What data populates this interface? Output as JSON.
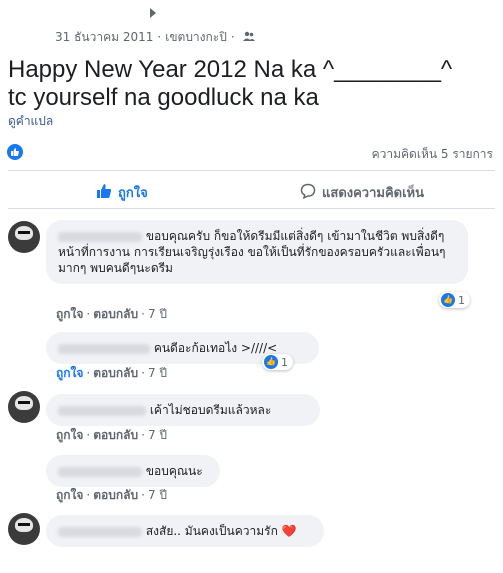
{
  "post": {
    "date": "31 ธันวาคม 2011",
    "location": "เขตบางกะปิ",
    "audience_icon": "friends-icon",
    "text_line1": "Happy New Year 2012 Na ka ^________^",
    "text_line2": "tc yourself na goodluck na ka",
    "see_translation": "ดูคำแปล",
    "comment_count": "ความคิดเห็น 5 รายการ"
  },
  "actions": {
    "like_label": "ถูกใจ",
    "comment_label": "แสดงความคิดเห็น"
  },
  "comments": [
    {
      "text": "ขอบคุณครับ ก็ขอให้ดรีมมีแต่สิ่งดีๆ เข้ามาในชีวิต พบสิ่งดีๆ หน้าที่การงาน การเรียนเจริญรุ่งเรือง ขอให้เป็นที่รักของครอบครัวและเพื่อนๆ มากๆ พบคนดีๆนะดรีม",
      "reactions": "1",
      "like": "ถูกใจ",
      "reply": "ตอบกลับ",
      "time": "7 ปี"
    },
    {
      "text": "คนดีอะก้อเทอไง >////<",
      "reactions": "1",
      "like": "ถูกใจ",
      "reply": "ตอบกลับ",
      "time": "7 ปี"
    },
    {
      "text": "เค้าไม่ชอบดรีมแล้วหละ",
      "like": "ถูกใจ",
      "reply": "ตอบกลับ",
      "time": "7 ปี"
    },
    {
      "text": "ขอบคุณนะ",
      "like": "ถูกใจ",
      "reply": "ตอบกลับ",
      "time": "7 ปี"
    },
    {
      "text": "สงสัย.. มันคงเป็นความรัก",
      "emoji": "❤️"
    }
  ],
  "colors": {
    "accent": "#1877f2",
    "muted": "#606770",
    "bubble": "#f0f2f5"
  }
}
